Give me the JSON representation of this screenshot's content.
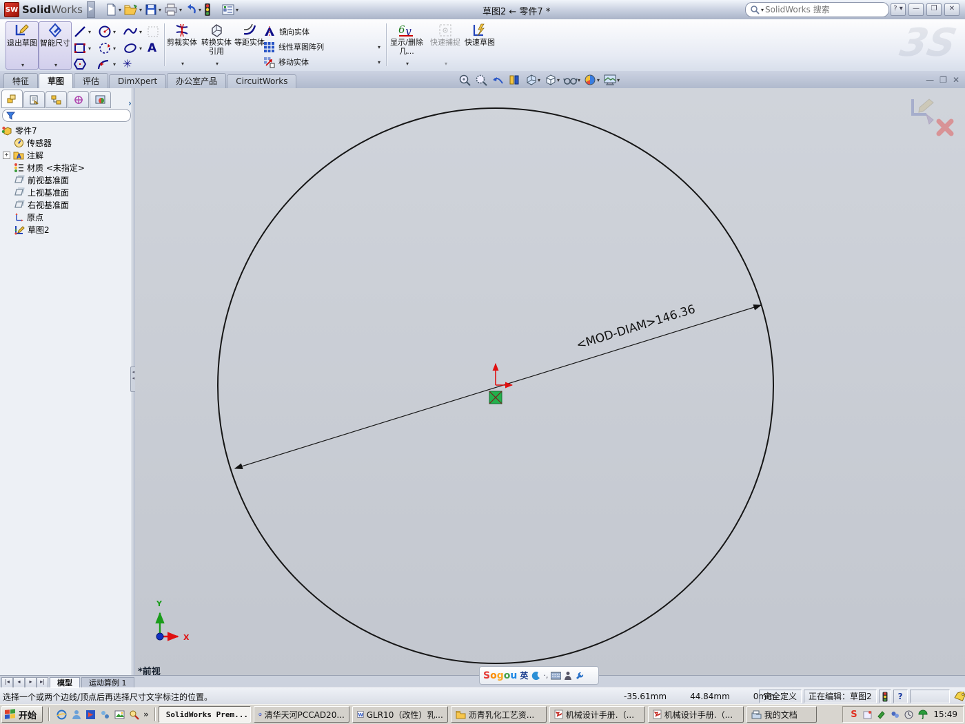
{
  "titlebar": {
    "logo_text": "SW",
    "app_name_bold": "Solid",
    "app_name_light": "Works",
    "doc_title": "草图2 ← 零件7 *",
    "search_placeholder": "SolidWorks 搜索",
    "help_label": "?"
  },
  "ribbon": {
    "exit_sketch": "退出草图",
    "smart_dimension": "智能尺寸",
    "trim_entities": "剪裁实体",
    "convert_entities": "转换实体引用",
    "offset_entities": "等距实体",
    "mirror_entities": "镜向实体",
    "linear_sketch_pattern": "线性草图阵列",
    "move_entities": "移动实体",
    "display_delete_relations": "显示/删除几...",
    "quick_snaps": "快速捕捉",
    "rapid_sketch": "快速草图",
    "text_tool": "A",
    "ds_watermark": "3S"
  },
  "command_tabs": {
    "items": [
      {
        "label": "特征"
      },
      {
        "label": "草图"
      },
      {
        "label": "评估"
      },
      {
        "label": "DimXpert"
      },
      {
        "label": "办公室产品"
      },
      {
        "label": "CircuitWorks"
      }
    ]
  },
  "feature_tree": {
    "root": "零件7",
    "items": [
      {
        "label": "传感器"
      },
      {
        "label": "注解"
      },
      {
        "label": "材质 <未指定>"
      },
      {
        "label": "前视基准面"
      },
      {
        "label": "上视基准面"
      },
      {
        "label": "右视基准面"
      },
      {
        "label": "原点"
      },
      {
        "label": "草图2"
      }
    ]
  },
  "viewport": {
    "dimension_label": "<MOD-DIAM>146.36",
    "view_name": "*前视",
    "axis_x": "X",
    "axis_y": "Y"
  },
  "sheet_tabs": {
    "model": "模型",
    "motion_study": "运动算例 1"
  },
  "statusbar": {
    "message": "选择一个或两个边线/顶点后再选择尺寸文字标注的位置。",
    "coord_x": "-35.61mm",
    "coord_y": "44.84mm",
    "coord_z": "0mm",
    "define_state": "完全定义",
    "editing": "正在编辑：草图2",
    "help_label": "?"
  },
  "ime_bar": {
    "logo_letters": [
      "S",
      "o",
      "g",
      "o",
      "u"
    ],
    "lang_mode": "英"
  },
  "taskbar": {
    "start_label": "开始",
    "tasks": [
      {
        "label": "SolidWorks Prem..."
      },
      {
        "label": "清华天河PCCAD20..."
      },
      {
        "label": "GLR10（改性）乳..."
      },
      {
        "label": "沥青乳化工艺资..."
      },
      {
        "label": "机械设计手册.（..."
      },
      {
        "label": "机械设计手册.（..."
      },
      {
        "label": "我的文档"
      }
    ],
    "tray_time": "15:49"
  },
  "icons": {
    "titlebar": [
      "new-document-icon",
      "open-folder-icon",
      "save-icon",
      "print-icon",
      "undo-icon",
      "rebuild-traffic-light-icon",
      "options-icon",
      "search-icon"
    ],
    "accent_colors": {
      "selection_green": "#22b14c",
      "axis_red": "#e01010",
      "axis_green": "#1a9c1a",
      "axis_blue": "#1030c0",
      "sketch_blue": "#2244bb"
    }
  }
}
